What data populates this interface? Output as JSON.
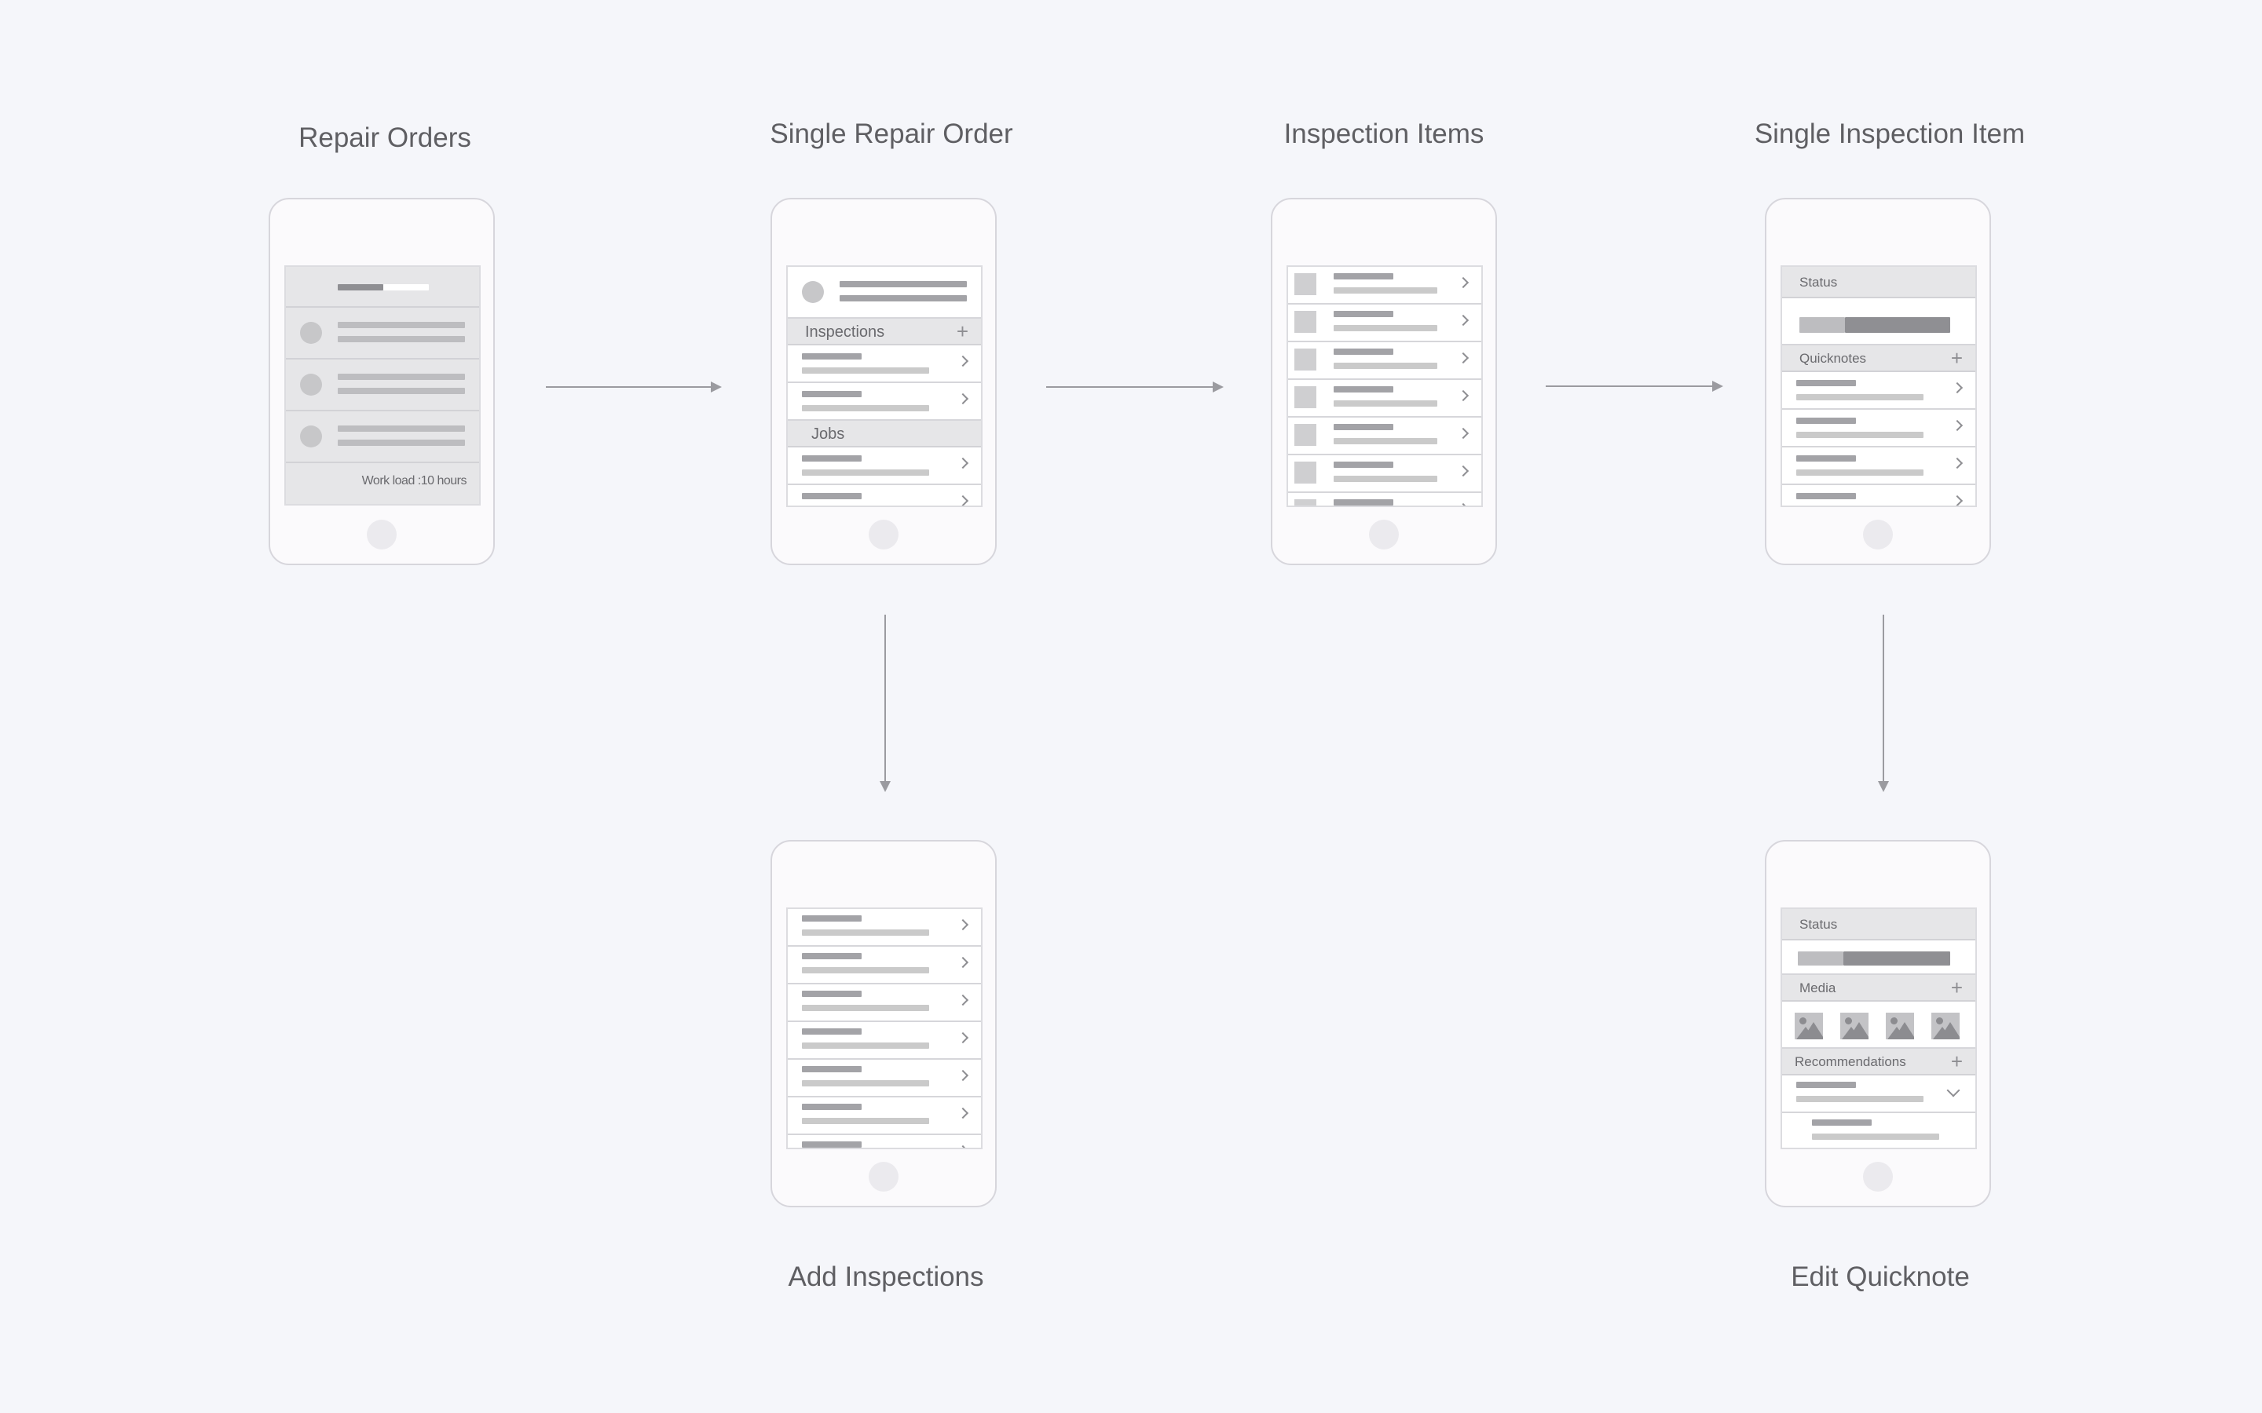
{
  "screens": {
    "repair_orders": {
      "title": "Repair Orders",
      "footer": "Work load :10 hours"
    },
    "single_repair_order": {
      "title": "Single Repair Order",
      "section_inspections": "Inspections",
      "section_jobs": "Jobs",
      "plus": "+"
    },
    "inspection_items": {
      "title": "Inspection Items"
    },
    "single_inspection_item": {
      "title": "Single Inspection Item",
      "section_status": "Status",
      "section_quicknotes": "Quicknotes",
      "plus": "+"
    },
    "add_inspections": {
      "title": "Add Inspections"
    },
    "edit_quicknote": {
      "title": "Edit Quicknote",
      "section_status": "Status",
      "section_media": "Media",
      "section_recommendations": "Recommendations",
      "plus": "+"
    }
  },
  "colors": {
    "background": "#f5f6fa",
    "phone_border": "#d7d6dc",
    "arrow": "#9b9ba0"
  },
  "icons": [
    "chevron-right-icon",
    "chevron-down-icon",
    "plus-icon",
    "image-placeholder-icon",
    "avatar-placeholder-icon"
  ]
}
